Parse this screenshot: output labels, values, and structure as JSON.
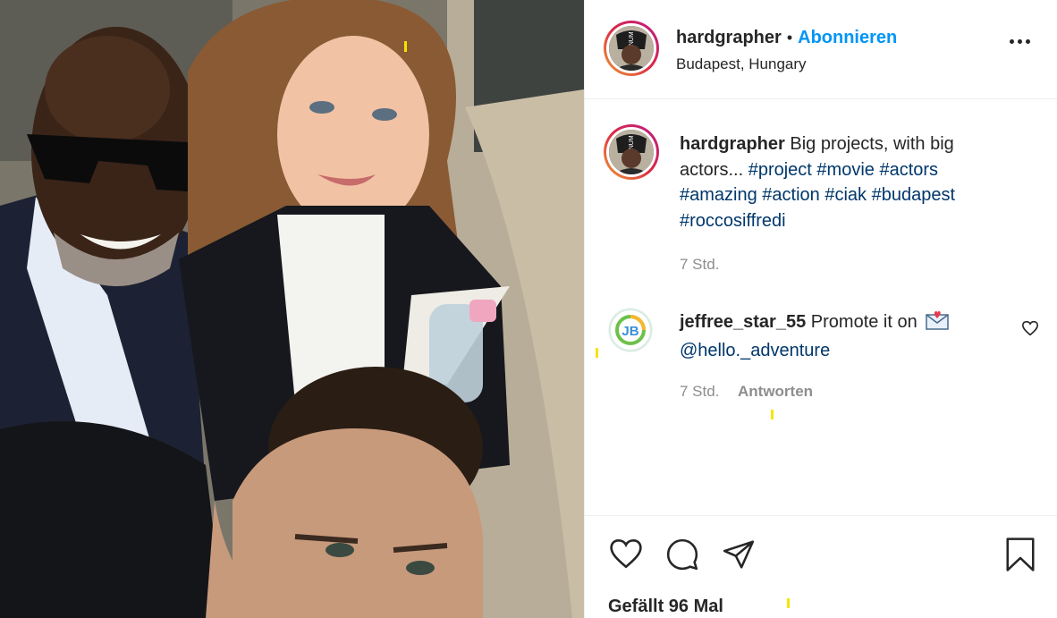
{
  "post": {
    "author": {
      "username": "hardgrapher",
      "follow_label": "Abonnieren",
      "location": "Budapest, Hungary",
      "avatar_icon": "profile-photo"
    },
    "caption": {
      "username": "hardgrapher",
      "text": "Big projects, with big actors...",
      "hashtags": [
        "#project",
        "#movie",
        "#actors",
        "#amazing",
        "#action",
        "#ciak",
        "#budapest",
        "#roccosiffredi"
      ],
      "time": "7 Std."
    },
    "comments": [
      {
        "username": "jeffree_star_55",
        "text": "Promote it on",
        "emoji_icon": "love-letter-icon",
        "mention": "@hello._adventure",
        "time": "7 Std.",
        "reply_label": "Antworten",
        "avatar_icon": "jb-logo"
      }
    ],
    "likes_label": "Gefällt 96 Mal",
    "actions": [
      "heart-icon",
      "comment-icon",
      "share-icon",
      "bookmark-icon"
    ],
    "colors": {
      "follow": "#0095f6",
      "hashtag": "#00376b",
      "muted": "#8e8e8e",
      "text": "#262626"
    }
  }
}
